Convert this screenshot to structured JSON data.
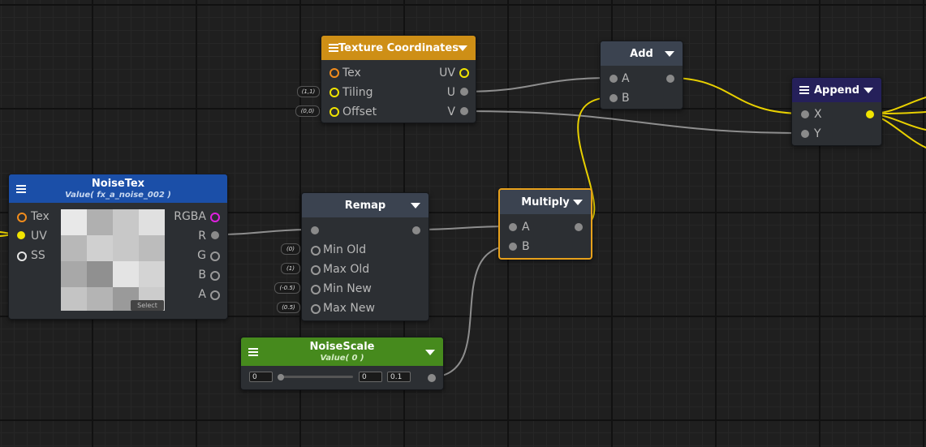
{
  "colors": {
    "header_texture": "#ce8f16",
    "header_default": "#3b4350",
    "header_append": "#25205a",
    "header_noisetex": "#1b4fa8",
    "header_noisescale": "#468a1d",
    "wire_yellow": "#e8d000",
    "wire_gray": "#8e8e8e",
    "selection": "#e8a11b"
  },
  "nodes": {
    "texcoords": {
      "title": "Texture Coordinates",
      "inputs": [
        "Tex",
        "Tiling",
        "Offset"
      ],
      "outputs": [
        "UV",
        "U",
        "V"
      ],
      "tiling_value": "(1,1)",
      "offset_value": "(0,0)"
    },
    "add": {
      "title": "Add",
      "inputs": [
        "A",
        "B"
      ]
    },
    "append": {
      "title": "Append",
      "inputs": [
        "X",
        "Y"
      ]
    },
    "noisetex": {
      "title": "NoiseTex",
      "subtitle": "Value( fx_a_noise_002 )",
      "inputs": [
        "Tex",
        "UV",
        "SS"
      ],
      "outputs": [
        "RGBA",
        "R",
        "G",
        "B",
        "A"
      ],
      "select_label": "Select",
      "preview_cells": [
        "#e8e8e8",
        "#b0b0b0",
        "#c8c8c8",
        "#e0e0e0",
        "#b8b8b8",
        "#d0d0d0",
        "#c8c8c8",
        "#bcbcbc",
        "#a8a8a8",
        "#909090",
        "#e4e4e4",
        "#d4d4d4",
        "#c4c4c4",
        "#b4b4b4",
        "#9a9a9a",
        "#cccccc"
      ]
    },
    "remap": {
      "title": "Remap",
      "inputs": [
        "Min Old",
        "Max Old",
        "Min New",
        "Max New"
      ],
      "values": [
        "(0)",
        "(1)",
        "(-0.5)",
        "(0.5)"
      ]
    },
    "multiply": {
      "title": "Multiply",
      "inputs": [
        "A",
        "B"
      ]
    },
    "noisescale": {
      "title": "NoiseScale",
      "subtitle": "Value( 0 )",
      "value": "0",
      "min": "0",
      "max": "0.1"
    }
  }
}
